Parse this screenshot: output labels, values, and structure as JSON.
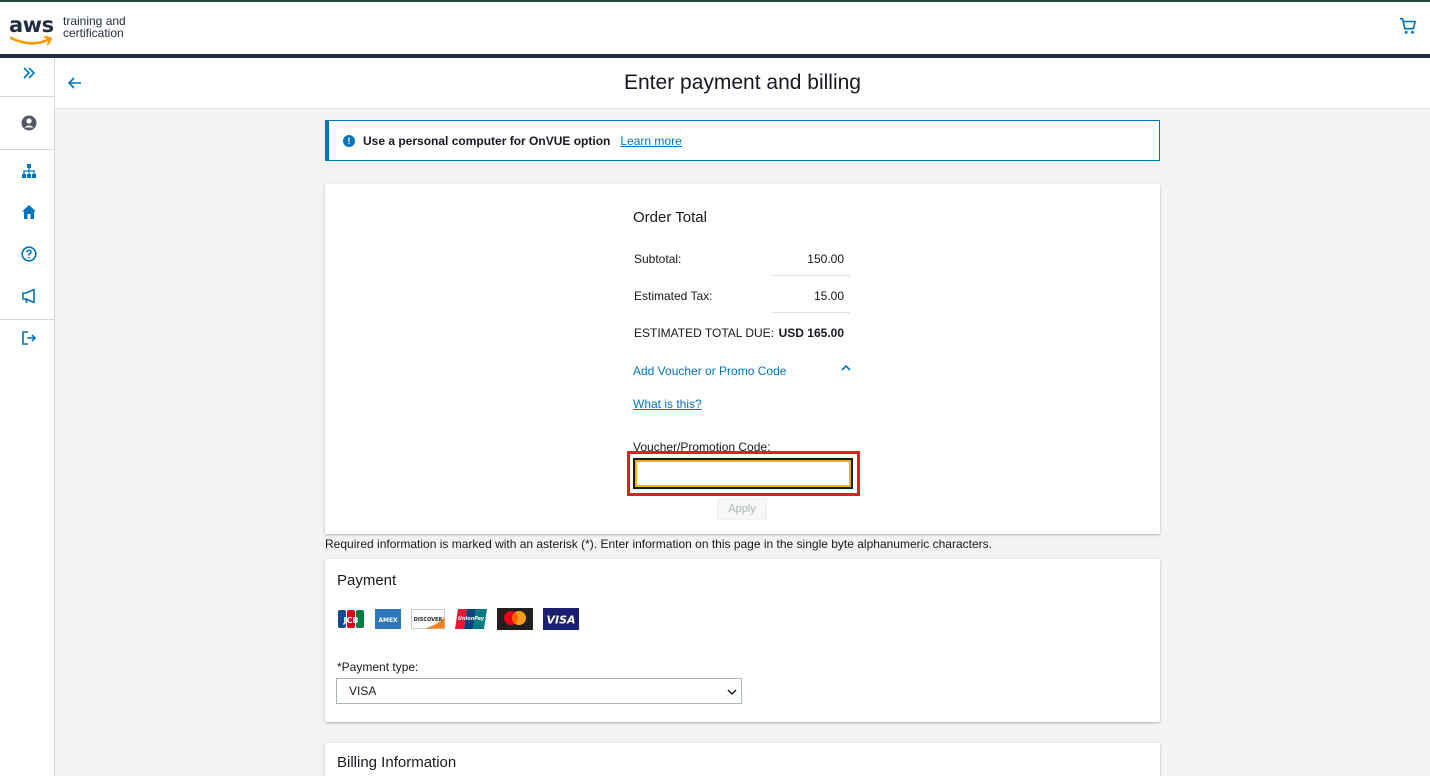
{
  "brand": {
    "logo_word": "aws",
    "logo_sub": "training and certification"
  },
  "header": {
    "title": "Enter payment and billing"
  },
  "info_banner": {
    "message": "Use a personal computer for OnVUE option",
    "link": "Learn more",
    "icon": "info-icon"
  },
  "order": {
    "title": "Order Total",
    "rows": [
      {
        "label": "Subtotal:",
        "value": "150.00"
      },
      {
        "label": "Estimated Tax:",
        "value": "15.00"
      },
      {
        "label": "ESTIMATED TOTAL DUE:",
        "value": "USD 165.00"
      }
    ],
    "voucher_toggle": "Add Voucher or Promo Code",
    "what_link": "What is this?",
    "voucher_label": "Voucher/Promotion Code:",
    "voucher_value": "",
    "apply_label": "Apply"
  },
  "required_note": "Required information is marked with an asterisk (*). Enter information on this page in the single byte alphanumeric characters.",
  "payment": {
    "title": "Payment",
    "card_brands": [
      "JCB",
      "AMEX",
      "DISCOVER",
      "UnionPay",
      "Mastercard",
      "VISA"
    ],
    "payment_type_label": "*Payment type:",
    "payment_type_value": "VISA"
  },
  "billing": {
    "title": "Billing Information"
  },
  "sidebar_icons": [
    "expand-icon",
    "user-icon",
    "sitemap-icon",
    "home-icon",
    "help-icon",
    "megaphone-icon",
    "sign-out-icon"
  ],
  "colors": {
    "link": "#0073bb",
    "dark": "#232f3e",
    "focus": "#e02020",
    "focus_inner": "#f0b400"
  }
}
